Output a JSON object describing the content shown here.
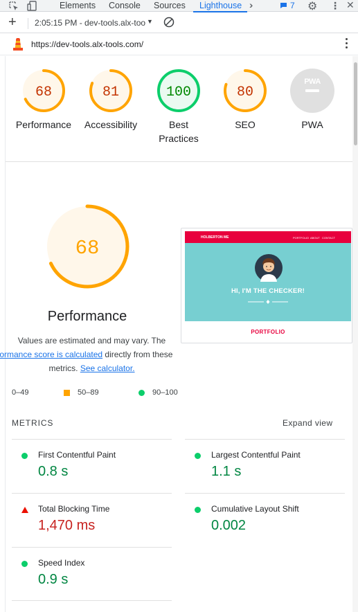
{
  "devtools": {
    "tabs": [
      {
        "label": "Elements"
      },
      {
        "label": "Console"
      },
      {
        "label": "Sources"
      },
      {
        "label": "Lighthouse"
      }
    ],
    "issues_count": "7"
  },
  "toolbar": {
    "report_label": "2:05:15 PM - dev-tools.alx-too"
  },
  "urlbar": {
    "url": "https://dev-tools.alx-tools.com/"
  },
  "categories": [
    {
      "score": "68",
      "label": "Performance",
      "value": 68,
      "status": "average"
    },
    {
      "score": "81",
      "label": "Accessibility",
      "value": 81,
      "status": "average"
    },
    {
      "score": "100",
      "label": "Best Practices",
      "label_line1": "Best",
      "label_line2": "Practices",
      "value": 100,
      "status": "pass"
    },
    {
      "score": "80",
      "label": "SEO",
      "value": 80,
      "status": "average"
    },
    {
      "score": "PWA",
      "label": "PWA",
      "value": null,
      "status": "na"
    }
  ],
  "performance": {
    "score": "68",
    "title": "Performance",
    "desc_line1": "Values are estimated and may vary. The",
    "desc_link": "rformance score is calculated",
    "desc_after_link": " directly from these",
    "desc_line3": "metrics. ",
    "see_calc": "See calculator."
  },
  "thumbnail": {
    "brand": "HOLBERTON ME",
    "nav_links": [
      "PORTFOLIO",
      "ABOUT",
      "CONTACT"
    ],
    "heading": "HI, I'M THE CHECKER!",
    "section": "PORTFOLIO"
  },
  "legend": {
    "fail": "0–49",
    "average": "50–89",
    "pass": "90–100"
  },
  "metrics": {
    "heading": "METRICS",
    "expand": "Expand view",
    "items": [
      {
        "label": "First Contentful Paint",
        "value": "0.8 s",
        "status": "pass"
      },
      {
        "label": "Largest Contentful Paint",
        "value": "1.1 s",
        "status": "pass"
      },
      {
        "label": "Total Blocking Time",
        "value": "1,470 ms",
        "status": "fail"
      },
      {
        "label": "Cumulative Layout Shift",
        "value": "0.002",
        "status": "pass"
      },
      {
        "label": "Speed Index",
        "value": "0.9 s",
        "status": "pass"
      }
    ]
  },
  "colors": {
    "average": "#ffa400",
    "average_bg": "#fff7ea",
    "average_text": "#c33300",
    "pass": "#0cce6b",
    "pass_bg": "#eafaf1",
    "pass_text": "#008800",
    "fail": "#eb0f00",
    "na": "#e0e0e0",
    "brand_red": "#e8003d",
    "hero_teal": "#77cfd1",
    "accent_blue": "#1a73e8"
  },
  "icons": [
    "inspect-icon",
    "device-toggle-icon",
    "more-tabs-icon",
    "issues-icon",
    "settings-gear-icon",
    "more-options-icon",
    "add-icon",
    "clear-icon",
    "lighthouse-logo-icon"
  ]
}
